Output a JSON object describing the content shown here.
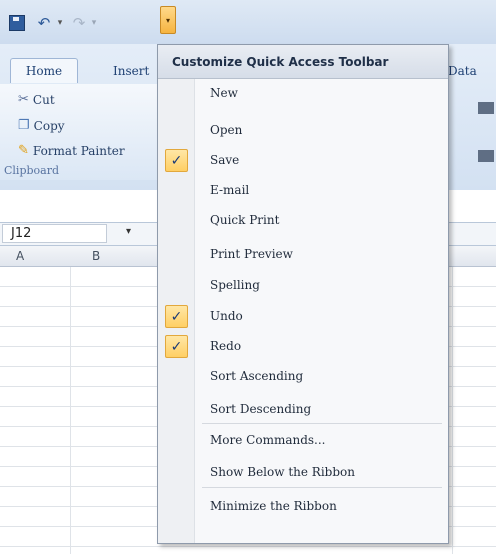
{
  "qat": {
    "undo_glyph": "↶",
    "redo_glyph": "↷",
    "dropdown_glyph": "▾",
    "customize_glyph": "▾"
  },
  "ribbon": {
    "tabs": {
      "home": "Home",
      "insert": "Insert",
      "data": "Data"
    },
    "clipboard": {
      "cut": "Cut",
      "copy": "Copy",
      "format_painter": "Format Painter",
      "group_label": "Clipboard"
    }
  },
  "formula_bar": {
    "name_box": "J12",
    "dropdown_glyph": "▾"
  },
  "grid": {
    "columns": [
      "A",
      "B"
    ]
  },
  "menu": {
    "title": "Customize Quick Access Toolbar",
    "check_glyph": "✓",
    "items": [
      {
        "label": "New",
        "checked": false
      },
      {
        "label": "Open",
        "checked": false
      },
      {
        "label": "Save",
        "checked": true
      },
      {
        "label": "E-mail",
        "checked": false
      },
      {
        "label": "Quick Print",
        "checked": false
      },
      {
        "label": "Print Preview",
        "checked": false
      },
      {
        "label": "Spelling",
        "checked": false
      },
      {
        "label": "Undo",
        "checked": true
      },
      {
        "label": "Redo",
        "checked": true
      },
      {
        "label": "Sort Ascending",
        "checked": false
      },
      {
        "label": "Sort Descending",
        "checked": false
      },
      {
        "label": "More Commands...",
        "checked": false
      },
      {
        "label": "Show Below the Ribbon",
        "checked": false
      },
      {
        "label": "Minimize the Ribbon",
        "checked": false
      }
    ],
    "accent_color": "#ffcf64"
  }
}
